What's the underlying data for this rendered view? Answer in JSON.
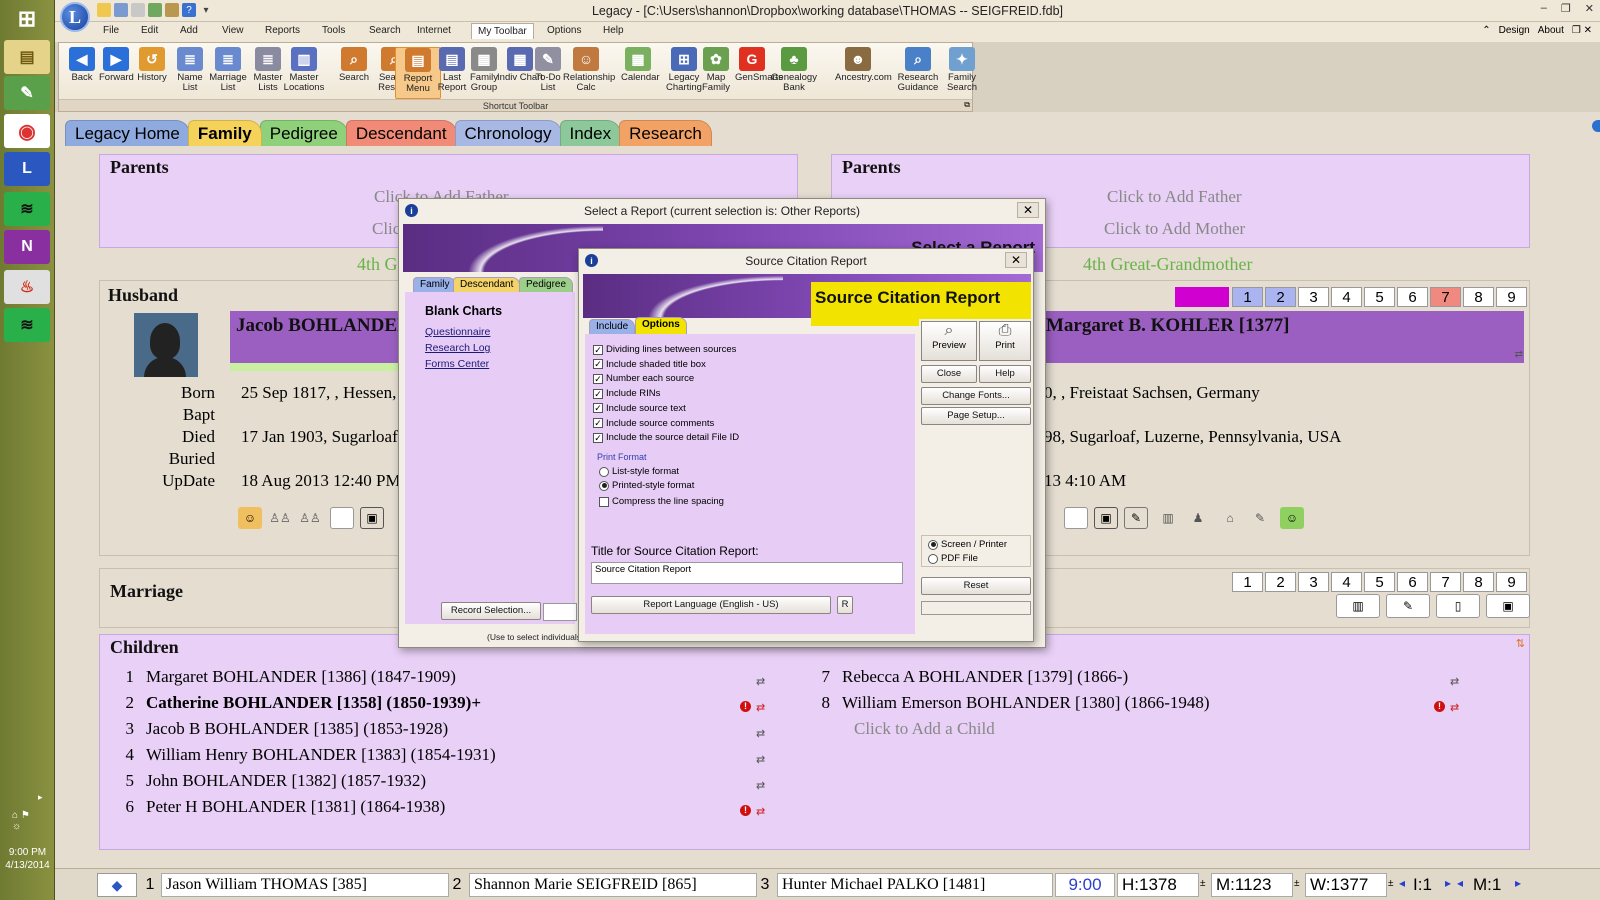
{
  "window": {
    "title": "Legacy - [C:\\Users\\shannon\\Dropbox\\working database\\THOMAS -- SEIGFREID.fdb]",
    "logo_letter": "L",
    "controls": {
      "minimize": "–",
      "restore": "❐",
      "close": "✕"
    }
  },
  "menu": {
    "items": [
      "File",
      "Edit",
      "Add",
      "View",
      "Reports",
      "Tools",
      "Search",
      "Internet",
      "My Toolbar",
      "Options",
      "Help"
    ],
    "right": [
      "Design",
      "About"
    ]
  },
  "toolbar": {
    "caption": "Shortcut Toolbar",
    "tools": [
      {
        "label": "Back",
        "icon": "back-arrow-icon",
        "glyph": "◀"
      },
      {
        "label": "Forward",
        "icon": "forward-arrow-icon",
        "glyph": "▶"
      },
      {
        "label": "History",
        "icon": "history-icon",
        "glyph": "↺"
      },
      {
        "label": "Name List",
        "icon": "name-list-icon",
        "glyph": "≣"
      },
      {
        "label": "Marriage List",
        "icon": "marriage-list-icon",
        "glyph": "≣"
      },
      {
        "label": "Master Lists",
        "icon": "master-lists-icon",
        "glyph": "≣"
      },
      {
        "label": "Master Locations",
        "icon": "master-locations-icon",
        "glyph": "▥"
      },
      {
        "label": "Search",
        "icon": "search-icon",
        "glyph": "⌕"
      },
      {
        "label": "Search Results",
        "icon": "search-results-icon",
        "glyph": "⌕"
      },
      {
        "label": "Report Menu",
        "icon": "report-menu-icon",
        "glyph": "▤"
      },
      {
        "label": "Last Report",
        "icon": "last-report-icon",
        "glyph": "▤"
      },
      {
        "label": "Family Group",
        "icon": "family-group-icon",
        "glyph": "▦"
      },
      {
        "label": "Indiv Chart",
        "icon": "indiv-chart-icon",
        "glyph": "▦"
      },
      {
        "label": "To-Do List",
        "icon": "todo-list-icon",
        "glyph": "✎"
      },
      {
        "label": "Relationship Calc",
        "icon": "relationship-calc-icon",
        "glyph": "☺"
      },
      {
        "label": "Calendar",
        "icon": "calendar-icon",
        "glyph": "▦"
      },
      {
        "label": "Legacy Charting",
        "icon": "charting-icon",
        "glyph": "⊞"
      },
      {
        "label": "Map Family",
        "icon": "map-family-icon",
        "glyph": "✿"
      },
      {
        "label": "GenSmarts",
        "icon": "gensmarts-icon",
        "glyph": "G"
      },
      {
        "label": "Genealogy Bank",
        "icon": "genealogy-bank-icon",
        "glyph": "♣"
      },
      {
        "label": "Ancestry.com",
        "icon": "ancestry-icon",
        "glyph": "☻"
      },
      {
        "label": "Research Guidance",
        "icon": "research-guidance-icon",
        "glyph": "⌕"
      },
      {
        "label": "Family Search",
        "icon": "family-search-icon",
        "glyph": "✦"
      }
    ]
  },
  "tabs": [
    {
      "label": "Legacy Home",
      "color": "#8eaadf"
    },
    {
      "label": "Family",
      "color": "#f5d35a"
    },
    {
      "label": "Pedigree",
      "color": "#8fd07a"
    },
    {
      "label": "Descendant",
      "color": "#f28a78"
    },
    {
      "label": "Chronology",
      "color": "#a7b8e4"
    },
    {
      "label": "Index",
      "color": "#8cc89a"
    },
    {
      "label": "Research",
      "color": "#f3a266"
    }
  ],
  "parents_left": {
    "title": "Parents",
    "add_father": "Click to Add Father",
    "add_mother": "Click to Add Mother",
    "generation": "4th Great-Grandfather"
  },
  "parents_right": {
    "title": "Parents",
    "add_father": "Click to Add Father",
    "add_mother": "Click to Add Mother",
    "generation": "4th Great-Grandmother"
  },
  "husband": {
    "title": "Husband",
    "name": "Jacob BOHLANDER [1358]",
    "facts": [
      {
        "label": "Born",
        "value": "25 Sep 1817, , Hessen, Germany"
      },
      {
        "label": "Bapt",
        "value": ""
      },
      {
        "label": "Died",
        "value": "17 Jan 1903, Sugarloaf, Luzerne, Pennsylvania, USA"
      },
      {
        "label": "Buried",
        "value": ""
      },
      {
        "label": "UpDate",
        "value": "18 Aug 2013 12:40 PM"
      }
    ]
  },
  "wife": {
    "name": "Margaret B. KOHLER [1377]",
    "facts": [
      {
        "label": "Born",
        "value": "0, , Freistaat Sachsen, Germany"
      },
      {
        "label": "Died",
        "value": "98, Sugarloaf, Luzerne, Pennsylvania, USA"
      },
      {
        "label": "UpDate",
        "value": "13 4:10 AM"
      }
    ]
  },
  "spouse_numbers": [
    "1",
    "2",
    "3",
    "4",
    "5",
    "6",
    "7",
    "8",
    "9"
  ],
  "marriage": {
    "title": "Marriage",
    "numbers": [
      "1",
      "2",
      "3",
      "4",
      "5",
      "6",
      "7",
      "8",
      "9"
    ]
  },
  "children": {
    "title": "Children",
    "left": [
      {
        "n": "1",
        "name": "Margaret BOHLANDER [1386] (1847-1909)",
        "bold": false,
        "alert": false
      },
      {
        "n": "2",
        "name": "Catherine BOHLANDER [1358] (1850-1939)+",
        "bold": true,
        "alert": true
      },
      {
        "n": "3",
        "name": "Jacob B BOHLANDER [1385] (1853-1928)",
        "bold": false,
        "alert": false
      },
      {
        "n": "4",
        "name": "William Henry BOHLANDER [1383] (1854-1931)",
        "bold": false,
        "alert": false
      },
      {
        "n": "5",
        "name": "John BOHLANDER [1382] (1857-1932)",
        "bold": false,
        "alert": false
      },
      {
        "n": "6",
        "name": "Peter H BOHLANDER [1381] (1864-1938)",
        "bold": false,
        "alert": true
      }
    ],
    "right": [
      {
        "n": "7",
        "name": "Rebecca A BOHLANDER [1379] (1866-)",
        "bold": false,
        "alert": false
      },
      {
        "n": "8",
        "name": "William Emerson BOHLANDER [1380] (1866-1948)",
        "bold": false,
        "alert": true
      }
    ],
    "add_child": "Click to Add a Child"
  },
  "status": {
    "slots": [
      {
        "n": "1",
        "name": "Jason William THOMAS [385]"
      },
      {
        "n": "2",
        "name": "Shannon Marie SEIGFREID [865]"
      },
      {
        "n": "3",
        "name": "Hunter Michael PALKO [1481]"
      }
    ],
    "time": "9:00",
    "h": "H:1378",
    "m": "M:1123",
    "w": "W:1377",
    "i": "I:1",
    "m2": "M:1"
  },
  "taskbar": {
    "clock_time": "9:00 PM",
    "clock_date": "4/13/2014"
  },
  "select_report": {
    "title": "Select a Report  (current selection is: Other Reports)",
    "banner": "Select a Report",
    "tabs": [
      "Family",
      "Descendant",
      "Pedigree"
    ],
    "section": "Blank Charts",
    "links": [
      "Questionnaire",
      "Research Log",
      "Forms Center"
    ],
    "record_selection": "Record Selection...",
    "hint": "(Use to select individuals, families, ancestor lines or entire family file.)"
  },
  "source_citation": {
    "title": "Source Citation Report",
    "banner": "Source Citation Report",
    "tabs": [
      "Include",
      "Options"
    ],
    "options": [
      {
        "label": "Dividing lines between sources",
        "checked": true
      },
      {
        "label": "Include shaded title box",
        "checked": true
      },
      {
        "label": "Number each source",
        "checked": true
      },
      {
        "label": "Include RINs",
        "checked": true
      },
      {
        "label": "Include source text",
        "checked": true
      },
      {
        "label": "Include source comments",
        "checked": true
      },
      {
        "label": "Include the source detail File ID",
        "checked": true
      }
    ],
    "print_format_label": "Print Format",
    "formats": [
      {
        "label": "List-style format",
        "checked": false
      },
      {
        "label": "Printed-style format",
        "checked": true
      }
    ],
    "compress": "Compress the line spacing",
    "title_label": "Title for Source Citation Report:",
    "title_value": "Source Citation Report",
    "language_button": "Report Language (English - US)",
    "r_button": "R",
    "buttons": {
      "preview": "Preview",
      "print": "Print",
      "close": "Close",
      "help": "Help",
      "change_fonts": "Change Fonts...",
      "page_setup": "Page Setup...",
      "reset": "Reset"
    },
    "output": [
      {
        "label": "Screen / Printer",
        "checked": true
      },
      {
        "label": "PDF File",
        "checked": false
      }
    ]
  }
}
